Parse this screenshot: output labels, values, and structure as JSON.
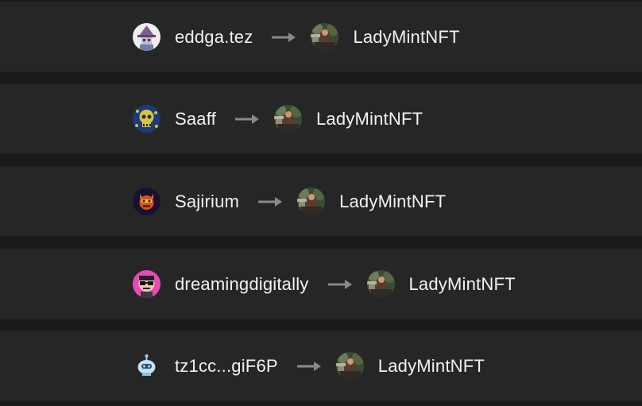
{
  "transfers": [
    {
      "from": {
        "name": "eddga.tez",
        "avatar": "wizard-avatar-icon"
      },
      "to": {
        "name": "LadyMintNFT",
        "avatar": "photo-avatar-icon"
      }
    },
    {
      "from": {
        "name": "Saaff",
        "avatar": "skull-avatar-icon"
      },
      "to": {
        "name": "LadyMintNFT",
        "avatar": "photo-avatar-icon"
      }
    },
    {
      "from": {
        "name": "Sajirium",
        "avatar": "mask-avatar-icon"
      },
      "to": {
        "name": "LadyMintNFT",
        "avatar": "photo-avatar-icon"
      }
    },
    {
      "from": {
        "name": "dreamingdigitally",
        "avatar": "sunglasses-avatar-icon"
      },
      "to": {
        "name": "LadyMintNFT",
        "avatar": "photo-avatar-icon"
      }
    },
    {
      "from": {
        "name": "tz1cc...giF6P",
        "avatar": "robot-avatar-icon"
      },
      "to": {
        "name": "LadyMintNFT",
        "avatar": "photo-avatar-icon"
      }
    }
  ],
  "arrow_icon": "arrow-right-icon",
  "colors": {
    "page_background": "#1a1a1a",
    "row_background": "#262626",
    "text": "#f2f2f2",
    "arrow": "#8a8a8a"
  }
}
